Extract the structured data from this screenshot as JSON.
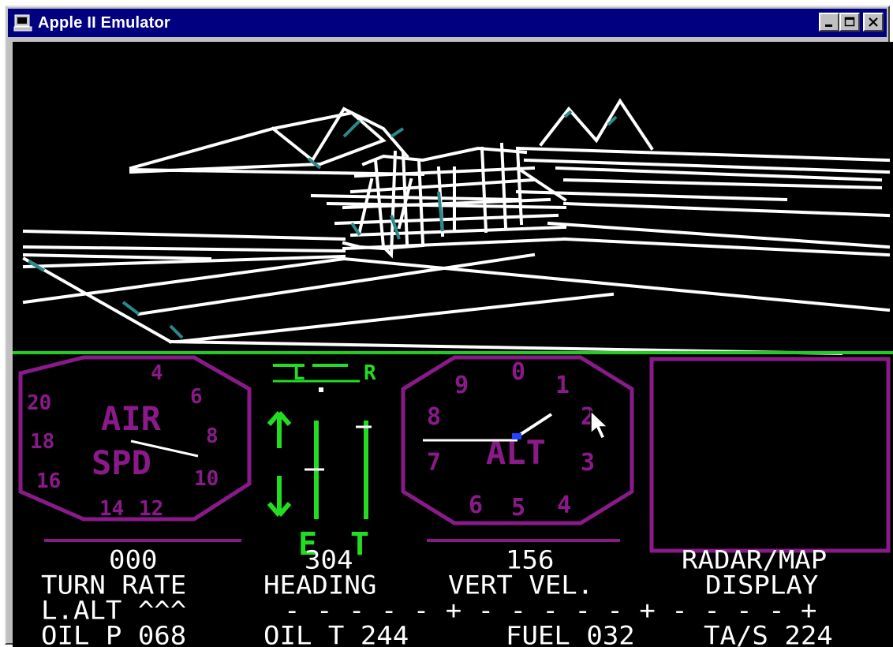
{
  "window": {
    "title": "Apple II Emulator",
    "icons": {
      "app": "computer-icon",
      "minimize": "minimize-icon",
      "maximize": "maximize-icon",
      "close": "close-icon"
    }
  },
  "instruments": {
    "airspeed": {
      "label_top": "AIR",
      "label_bottom": "SPD",
      "scale": [
        "4",
        "6",
        "8",
        "10",
        "12",
        "14",
        "16",
        "18",
        "20"
      ]
    },
    "attitude": {
      "lr_left": "L",
      "lr_right": "R",
      "bottom_left": "E",
      "bottom_right": "T"
    },
    "altimeter": {
      "label": "ALT",
      "scale": [
        "0",
        "1",
        "2",
        "3",
        "4",
        "5",
        "6",
        "7",
        "8",
        "9"
      ]
    },
    "radar": {
      "panel": "radar-map-display"
    }
  },
  "readouts": {
    "turn_rate_value": "000",
    "heading_value": "304",
    "vert_vel_value": "156",
    "radar_label_1": "RADAR/MAP",
    "turn_rate_label": "TURN RATE",
    "heading_label": "HEADING",
    "vert_vel_label": "VERT VEL.",
    "radar_label_2": "DISPLAY",
    "lalt_label": "L.ALT ^^^",
    "trim_scale": "- - - - - + - - - - - + - - - - +",
    "oil_p": "OIL P 068",
    "oil_t": "OIL T 244",
    "fuel": "FUEL 032",
    "tas": "TA/S 224"
  },
  "colors": {
    "screen": "#000000",
    "panel_divider": "#22cc22",
    "gauge_purple": "#8a1a8a",
    "indicator_green": "#22dd22",
    "wireframe": "#ffffff",
    "wireframe_cyan": "#2a8a8a",
    "titlebar": "#000080"
  }
}
